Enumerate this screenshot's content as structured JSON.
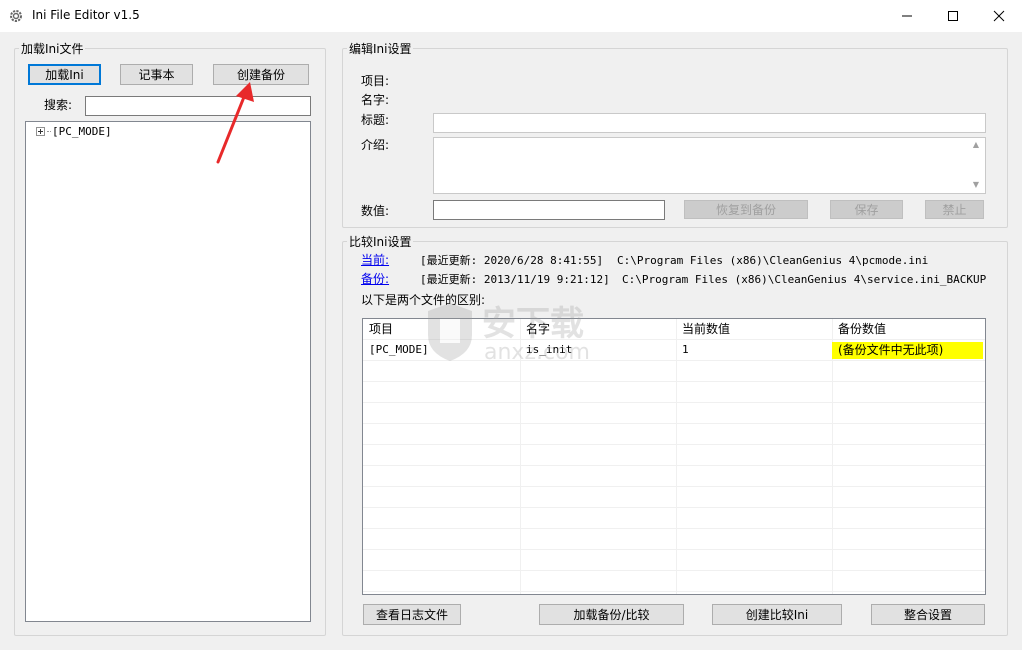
{
  "window": {
    "title": "Ini File Editor v1.5",
    "controls": {
      "minimize": "minimize-icon",
      "maximize": "maximize-icon",
      "close": "close-icon"
    }
  },
  "load_panel": {
    "title": "加载Ini文件",
    "buttons": {
      "load": "加载Ini",
      "notepad": "记事本",
      "backup": "创建备份"
    },
    "search_label": "搜索:",
    "search_value": "",
    "tree": [
      {
        "label": "[PC_MODE]",
        "expanded": false
      }
    ]
  },
  "edit_panel": {
    "title": "编辑Ini设置",
    "item_label": "项目:",
    "name_label": "名字:",
    "caption_label": "标题:",
    "intro_label": "介绍:",
    "value_label": "数值:",
    "buttons": {
      "restore": "恢复到备份",
      "save": "保存",
      "disable": "禁止"
    }
  },
  "compare_panel": {
    "title": "比较Ini设置",
    "current": {
      "link": "当前:",
      "updated": "[最近更新: 2020/6/28 8:41:55]",
      "path": "C:\\Program Files (x86)\\CleanGenius 4\\pcmode.ini"
    },
    "backup": {
      "link": "备份:",
      "updated": "[最近更新: 2013/11/19 9:21:12]",
      "path": "C:\\Program Files (x86)\\CleanGenius 4\\service.ini_BACKUP"
    },
    "diff_label": "以下是两个文件的区别:",
    "columns": [
      "项目",
      "名字",
      "当前数值",
      "备份数值"
    ],
    "rows": [
      {
        "item": "[PC_MODE]",
        "name": "is_init",
        "current": "1",
        "backup": "(备份文件中无此项)"
      }
    ],
    "highlight_color": "#ffff00",
    "buttons": {
      "log": "查看日志文件",
      "load_compare": "加载备份/比较",
      "create_compare": "创建比较Ini",
      "merge": "整合设置"
    }
  },
  "watermark": {
    "text_cn": "安下载",
    "text_en": "anxz.com"
  },
  "annotation": {
    "arrow_color": "#e8292a"
  }
}
